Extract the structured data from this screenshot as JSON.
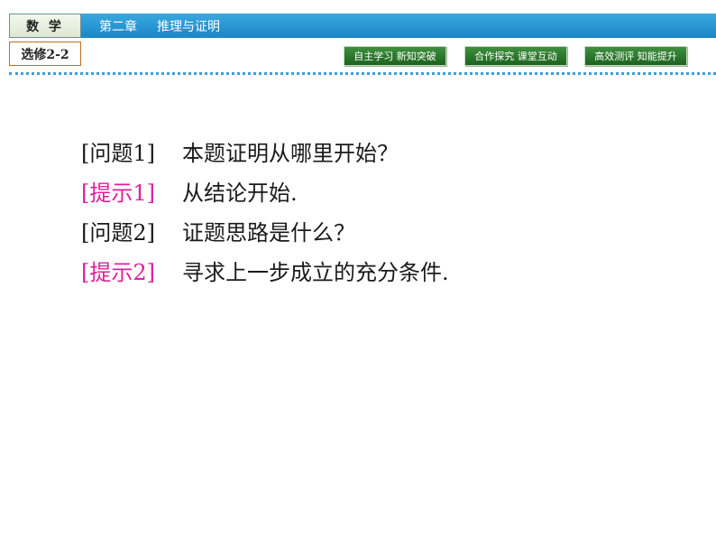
{
  "header": {
    "subject": "数 学",
    "course": "选修2-2",
    "chapter": "第二章",
    "chapter_title": "推理与证明"
  },
  "nav": {
    "btn1": "自主学习 新知突破",
    "btn2": "合作探究 课堂互动",
    "btn3": "高效测评 知能提升"
  },
  "content": {
    "lines": [
      {
        "tag": "[问题1]",
        "text": "本题证明从哪里开始？"
      },
      {
        "tag": "[提示1]",
        "text": "从结论开始."
      },
      {
        "tag": "[问题2]",
        "text": "证题思路是什么？"
      },
      {
        "tag": "[提示2]",
        "text": "寻求上一步成立的充分条件."
      }
    ]
  },
  "colors": {
    "chapter_bar": "#1a86c7",
    "nav_button": "#2a7a2c",
    "hint_tag": "#e0209a",
    "course_border": "#c0701a"
  }
}
